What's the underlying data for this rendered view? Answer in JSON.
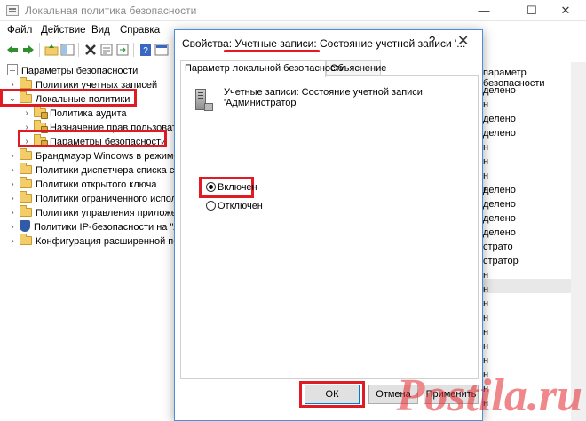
{
  "window": {
    "title": "Локальная политика безопасности",
    "minimize": "—",
    "maximize": "☐",
    "close": "✕"
  },
  "menu": [
    "Файл",
    "Действие",
    "Вид",
    "Справка"
  ],
  "toolbar_icons": [
    "back-arrow-icon",
    "forward-arrow-icon",
    "up-folder-icon",
    "show-hide-tree-icon",
    "delete-icon",
    "properties-icon",
    "export-list-icon",
    "help-icon",
    "console-icon"
  ],
  "tree": [
    {
      "label": "Параметры безопасности",
      "icon": "policy-doc-icon"
    },
    {
      "label": "Политики учетных записей",
      "icon": "folder-icon"
    },
    {
      "label": "Локальные политики",
      "icon": "folder-open-icon"
    },
    {
      "label": "Политика аудита",
      "icon": "folder-lock-icon"
    },
    {
      "label": "Назначение прав пользовател",
      "icon": "folder-lock-icon"
    },
    {
      "label": "Параметры безопасности",
      "icon": "folder-lock-icon"
    },
    {
      "label": "Брандмауэр Windows в режиме по",
      "icon": "folder-icon"
    },
    {
      "label": "Политики диспетчера списка сете",
      "icon": "folder-icon"
    },
    {
      "label": "Политики открытого ключа",
      "icon": "folder-icon"
    },
    {
      "label": "Политики ограниченного исполь",
      "icon": "folder-icon"
    },
    {
      "label": "Политики управления приложени",
      "icon": "folder-icon"
    },
    {
      "label": "Политики IP-безопасности на \"Ло",
      "icon": "shield-icon"
    },
    {
      "label": "Конфигурация расширенной поли",
      "icon": "folder-icon"
    }
  ],
  "right_column": {
    "header": "параметр безопасности",
    "cells": [
      "делено",
      "н",
      "делено",
      "делено",
      "н",
      "н",
      "н",
      "н",
      "делено",
      "делено",
      "делено",
      "делено",
      "страто",
      "стратор",
      "н",
      "н",
      "н",
      "н",
      "н",
      "н",
      "н",
      "н",
      "н",
      "н"
    ]
  },
  "dialog": {
    "title": "Свойства: Учетные записи: Состояние учетной записи '...",
    "help": "?",
    "close": "✕",
    "tabs": [
      "Параметр локальной безопасности",
      "Объяснение"
    ],
    "setting_name": "Учетные записи: Состояние учетной записи 'Администратор'",
    "options": [
      {
        "label": "Включен",
        "checked": true
      },
      {
        "label": "Отключен",
        "checked": false
      }
    ],
    "buttons": {
      "ok": "ОК",
      "cancel": "Отмена",
      "apply": "Применить"
    }
  },
  "watermark": "Postila.ru",
  "colors": {
    "highlight": "#e01b24",
    "dialog_border": "#4a90d9",
    "watermark": "#e3262b"
  }
}
